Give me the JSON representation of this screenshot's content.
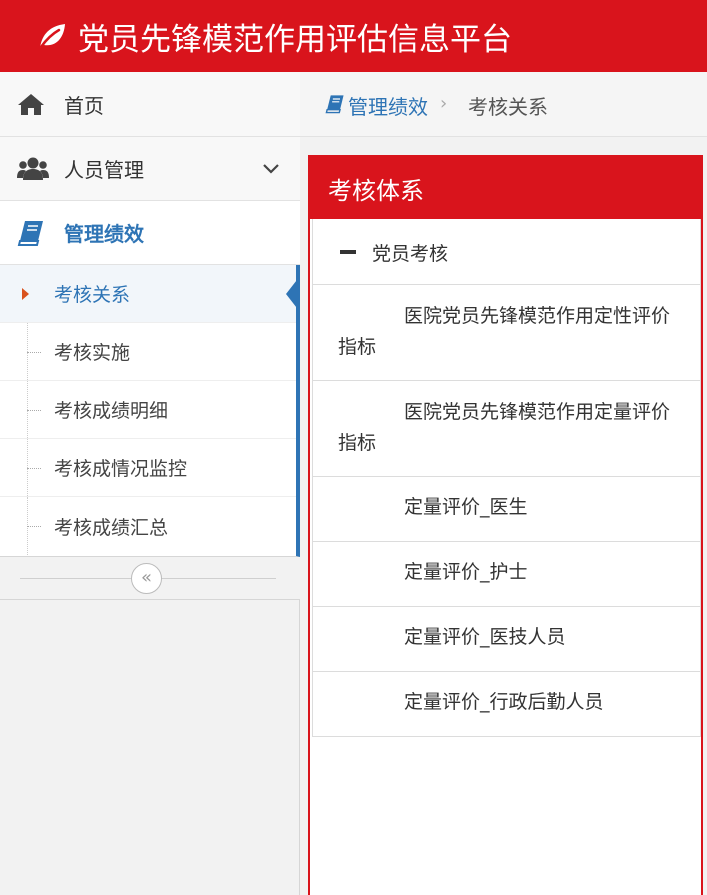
{
  "header": {
    "title": "党员先锋模范作用评估信息平台",
    "icon": "leaf-icon"
  },
  "sidebar": {
    "items": [
      {
        "label": "首页",
        "icon": "home-icon"
      },
      {
        "label": "人员管理",
        "icon": "users-icon"
      },
      {
        "label": "管理绩效",
        "icon": "book-icon"
      }
    ],
    "submenu": [
      {
        "label": "考核关系"
      },
      {
        "label": "考核实施"
      },
      {
        "label": "考核成绩明细"
      },
      {
        "label": "考核成情况监控"
      },
      {
        "label": "考核成绩汇总"
      }
    ],
    "collapse_glyph": "«"
  },
  "breadcrumb": {
    "parent": "管理绩效",
    "separator": "›",
    "current": "考核关系"
  },
  "panel": {
    "title": "考核体系",
    "root": "党员考核",
    "children": [
      "医院党员先锋模范作用定性评价指标",
      "医院党员先锋模范作用定量评价指标",
      "定量评价_医生",
      "定量评价_护士",
      "定量评价_医技人员",
      "定量评价_行政后勤人员"
    ]
  },
  "colors": {
    "brand_red": "#d9141c",
    "accent_blue": "#2e74b5"
  }
}
